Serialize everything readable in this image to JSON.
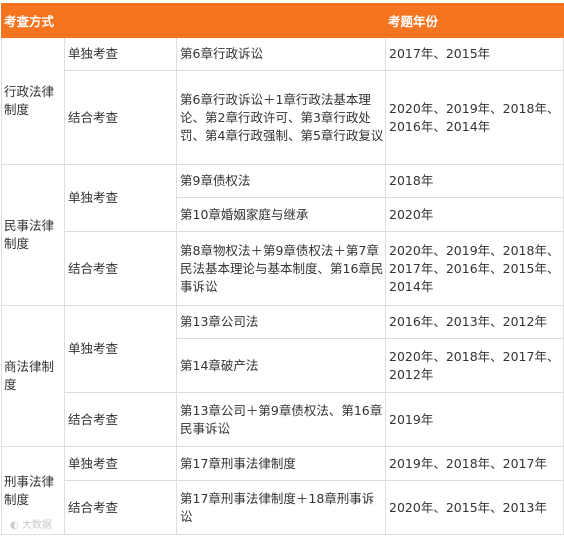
{
  "header": {
    "method": "考查方式",
    "year": "考题年份"
  },
  "rows": [
    {
      "cat": "行政法律制度",
      "kind": "单独考查",
      "chapters": "第6章行政诉讼",
      "years": "2017年、2015年"
    },
    {
      "kind": "结合考查",
      "chapters": "第6章行政诉讼＋1章行政法基本理论、第2章行政许可、第3章行政处罚、第4章行政强制、第5章行政复议",
      "years": "2020年、2019年、2018年、2016年、2014年"
    },
    {
      "cat": "民事法律制度",
      "kind": "单独考查",
      "chapters": "第9章债权法",
      "years": "2018年"
    },
    {
      "chapters": "第10章婚姻家庭与继承",
      "years": "2020年"
    },
    {
      "kind": "结合考查",
      "chapters": "第8章物权法＋第9章债权法＋第7章民法基本理论与基本制度、第16章民事诉讼",
      "years": "2020年、2019年、2018年、2017年、2016年、2015年、2014年"
    },
    {
      "cat": "商法律制度",
      "kind": "单独考查",
      "chapters": "第13章公司法",
      "years": "2016年、2013年、2012年"
    },
    {
      "chapters": "第14章破产法",
      "years": "2020年、2018年、2017年、2012年"
    },
    {
      "kind": "结合考查",
      "chapters": "第13章公司＋第9章债权法、第16章民事诉讼",
      "years": "2019年"
    },
    {
      "cat": "刑事法律制度",
      "kind": "单独考查",
      "chapters": "第17章刑事法律制度",
      "years": "2019年、2018年、2017年"
    },
    {
      "kind": "结合考查",
      "chapters": "第17章刑事法律制度＋18章刑事诉讼",
      "years": "2020年、2015年、2013年"
    }
  ],
  "watermark": "大数据"
}
